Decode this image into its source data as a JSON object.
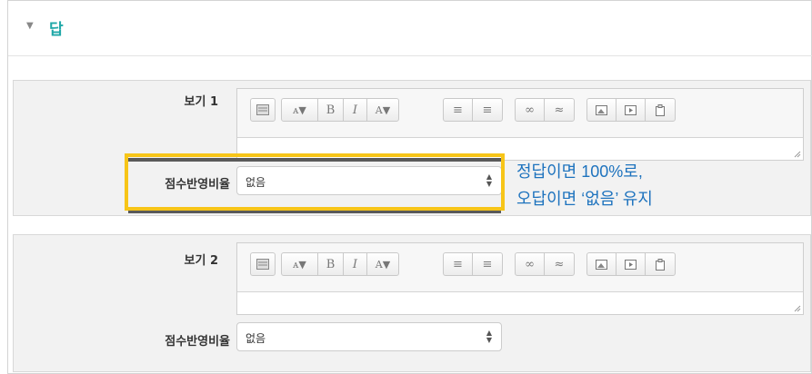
{
  "section": {
    "toggle_icon": "triangle-down-icon",
    "title": "답"
  },
  "toolbar": {
    "buttons": [
      "",
      "A",
      "B",
      "I",
      "A",
      "",
      "",
      "",
      "",
      "",
      "",
      ""
    ],
    "icons": [
      "toolbar-toggle-icon",
      "font-size-icon",
      "bold-icon",
      "italic-icon",
      "font-color-icon",
      "unordered-list-icon",
      "ordered-list-icon",
      "link-icon",
      "unlink-icon",
      "image-icon",
      "media-icon",
      "paste-icon"
    ]
  },
  "choices": [
    {
      "label": "보기 1",
      "grade_label": "점수반영비율",
      "grade_value": "없음"
    },
    {
      "label": "보기 2",
      "grade_label": "점수반영비율",
      "grade_value": "없음"
    }
  ],
  "annotation": {
    "line1": "정답이면 100%로,",
    "line2": "오답이면 ‘없음’ 유지",
    "highlight_color": "#f7c518",
    "text_color": "#1e73be"
  },
  "colors": {
    "title": "#20a8a8",
    "panel_bg": "#f2f2f2"
  }
}
